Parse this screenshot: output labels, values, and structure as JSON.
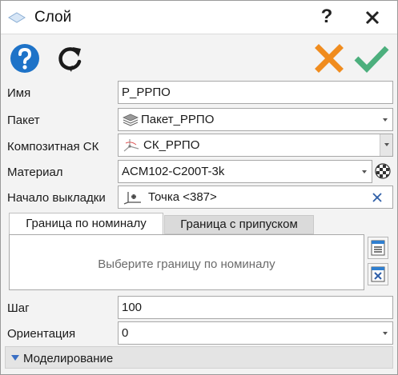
{
  "window": {
    "title": "Слой",
    "help_glyph": "?",
    "close_icon": "close-icon"
  },
  "toolbar": {
    "help_icon": "help-circle-icon",
    "refresh_icon": "refresh-icon",
    "cancel_icon": "cancel-x-icon",
    "ok_icon": "checkmark-icon",
    "colors": {
      "help": "#1e73c8",
      "cancel": "#f08c1e",
      "ok": "#4caf7d"
    }
  },
  "form": {
    "name": {
      "label": "Имя",
      "value": "P_PPПО"
    },
    "package": {
      "label": "Пакет",
      "value": "Пакет_РРПО"
    },
    "cs": {
      "label": "Композитная СК",
      "value": "СК_РРПО"
    },
    "material": {
      "label": "Материал",
      "value": "ACM102-C200T-3k"
    },
    "start": {
      "label": "Начало выкладки",
      "value": "Точка <387>"
    },
    "step": {
      "label": "Шаг",
      "value": "100"
    },
    "orientation": {
      "label": "Ориентация",
      "value": "0"
    }
  },
  "tabs": [
    {
      "label": "Граница по номиналу",
      "active": true
    },
    {
      "label": "Граница с припуском",
      "active": false
    }
  ],
  "border_panel": {
    "placeholder": "Выберите границу по номиналу"
  },
  "section": {
    "label": "Моделирование"
  }
}
